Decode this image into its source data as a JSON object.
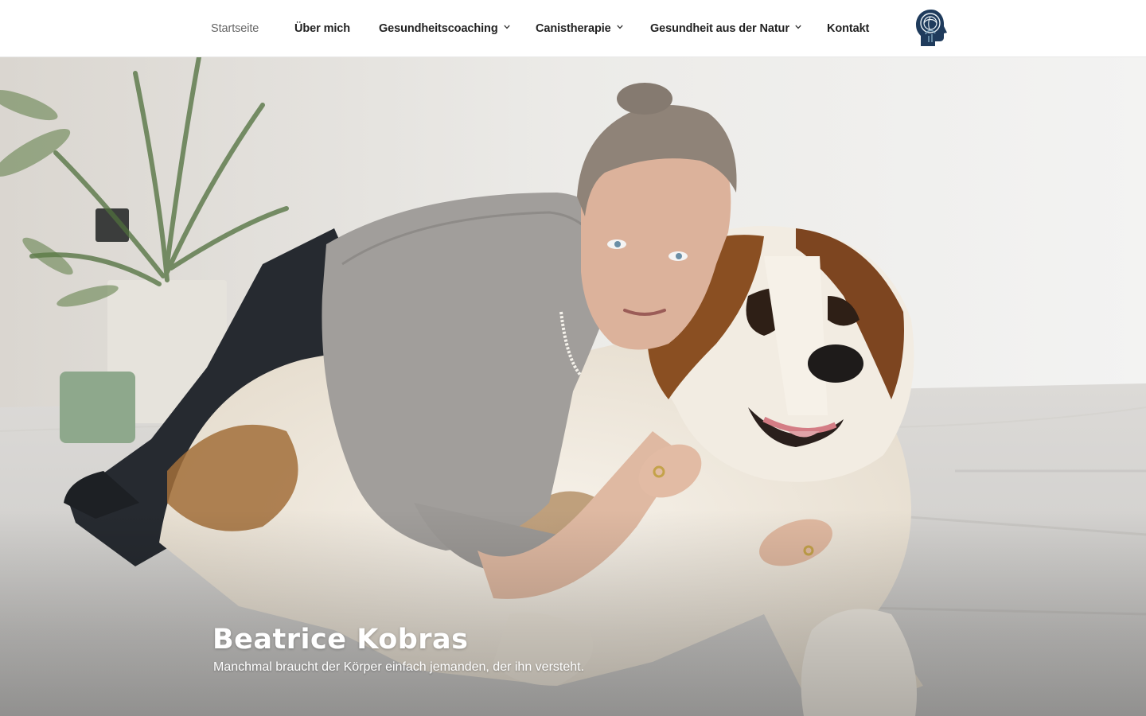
{
  "nav": {
    "items": [
      {
        "label": "Startseite",
        "has_dropdown": false,
        "current": true
      },
      {
        "label": "Über mich",
        "has_dropdown": false,
        "current": false
      },
      {
        "label": "Gesundheitscoaching",
        "has_dropdown": true,
        "current": false
      },
      {
        "label": "Canistherapie",
        "has_dropdown": true,
        "current": false
      },
      {
        "label": "Gesundheit aus der Natur",
        "has_dropdown": true,
        "current": false
      },
      {
        "label": "Kontakt",
        "has_dropdown": false,
        "current": false
      }
    ],
    "logo_icon": "head-brain-logo-icon"
  },
  "hero": {
    "title": "Beatrice Kobras",
    "subtitle": "Manchmal braucht der Körper einfach jemanden, der ihn versteht.",
    "image_icon": "woman-with-dog-photo"
  },
  "colors": {
    "nav_text": "#222222",
    "nav_current": "#666666",
    "logo_blue": "#1f3b5c",
    "hero_text": "#ffffff"
  }
}
